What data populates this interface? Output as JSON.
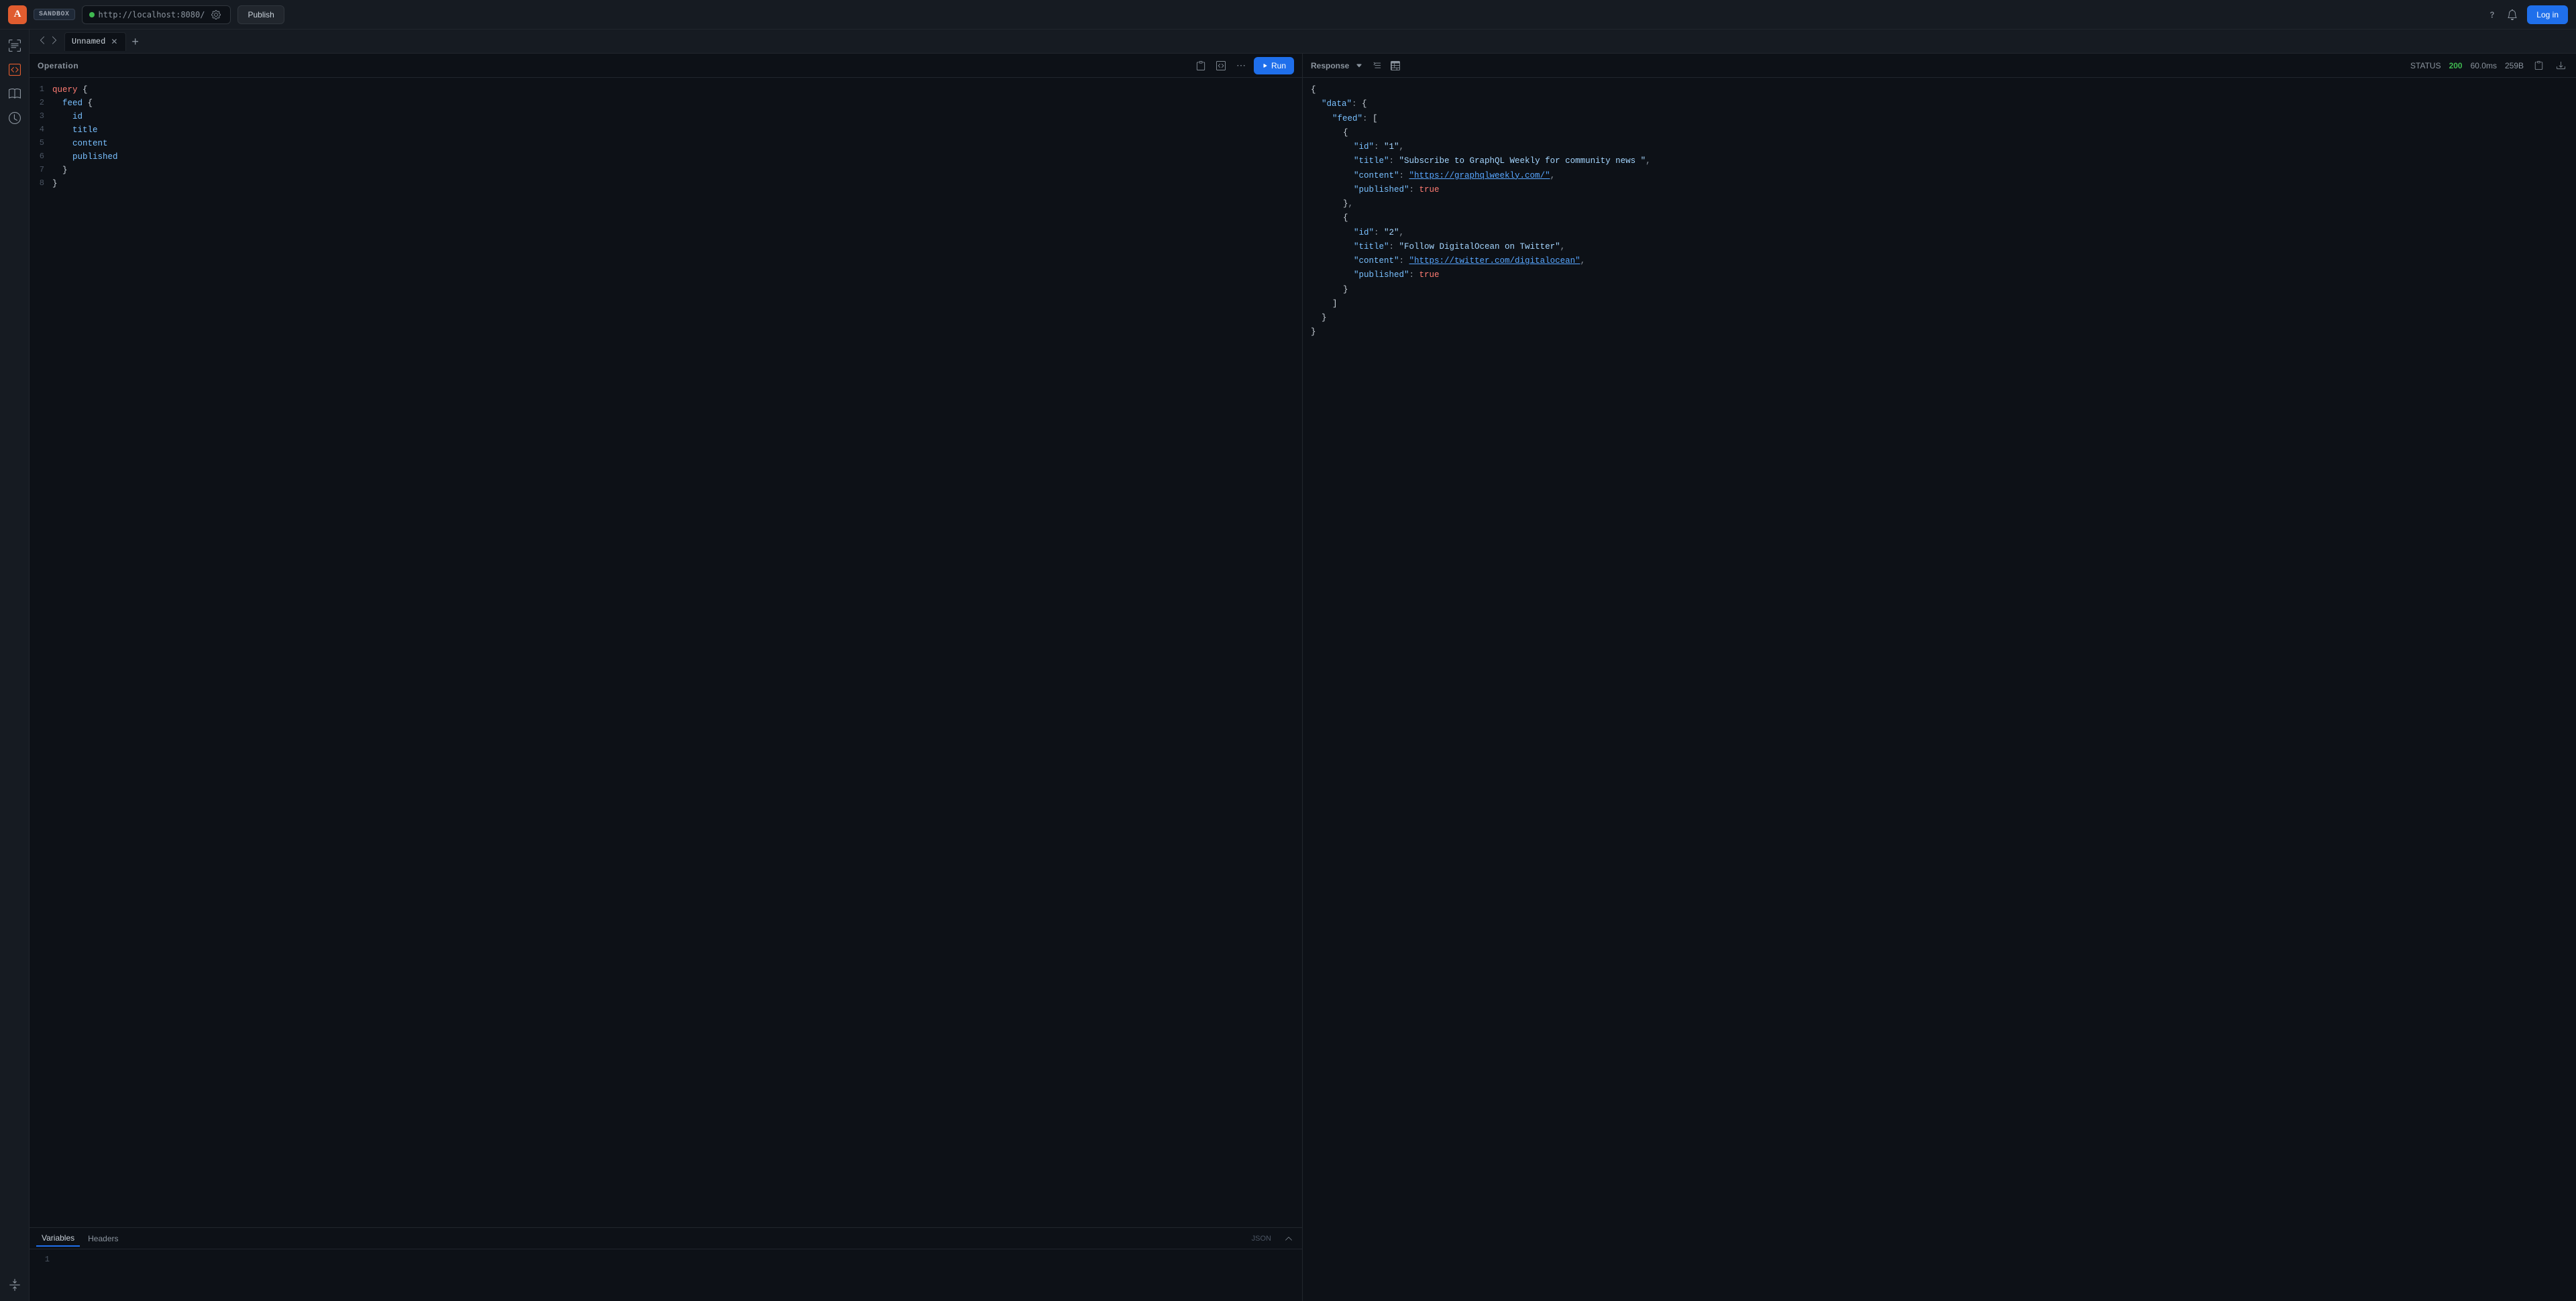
{
  "topbar": {
    "sandbox_label": "SANDBOX",
    "url": "http://localhost:8080/",
    "publish_label": "Publish",
    "login_label": "Log in"
  },
  "tabs": [
    {
      "label": "Unnamed",
      "active": true
    }
  ],
  "operation": {
    "title": "Operation",
    "run_label": "Run",
    "code_lines": [
      {
        "num": 1,
        "content": "query {"
      },
      {
        "num": 2,
        "content": "  feed {"
      },
      {
        "num": 3,
        "content": "    id"
      },
      {
        "num": 4,
        "content": "    title"
      },
      {
        "num": 5,
        "content": "    content"
      },
      {
        "num": 6,
        "content": "    published"
      },
      {
        "num": 7,
        "content": "  }"
      },
      {
        "num": 8,
        "content": "}"
      }
    ]
  },
  "bottom_panel": {
    "variables_tab": "Variables",
    "headers_tab": "Headers",
    "json_label": "JSON",
    "line_number": 1
  },
  "response": {
    "title": "Response",
    "status_label": "STATUS",
    "status_code": "200",
    "time": "60.0ms",
    "size": "259B",
    "data": {
      "feed": [
        {
          "id": "1",
          "title": "Subscribe to GraphQL Weekly for community news ",
          "content": "https://graphqlweekly.com/",
          "published": true
        },
        {
          "id": "2",
          "title": "Follow DigitalOcean on Twitter",
          "content": "https://twitter.com/digitalocean",
          "published": true
        }
      ]
    }
  }
}
